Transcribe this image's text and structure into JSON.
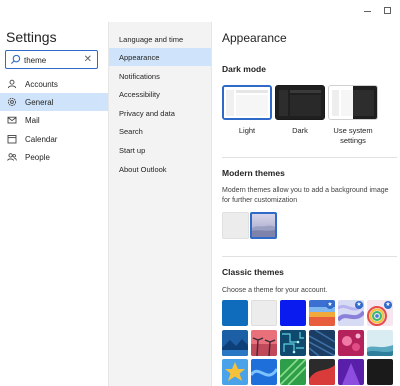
{
  "window": {
    "minimize_icon": "minimize-icon",
    "maximize_icon": "maximize-icon"
  },
  "sidebar": {
    "title": "Settings",
    "search": {
      "value": "theme",
      "clear_icon": "✕"
    },
    "items": [
      {
        "label": "Accounts",
        "icon": "person-icon",
        "active": false
      },
      {
        "label": "General",
        "icon": "gear-icon",
        "active": true
      },
      {
        "label": "Mail",
        "icon": "mail-icon",
        "active": false
      },
      {
        "label": "Calendar",
        "icon": "calendar-icon",
        "active": false
      },
      {
        "label": "People",
        "icon": "people-icon",
        "active": false
      }
    ]
  },
  "subnav": {
    "items": [
      {
        "label": "Language and time",
        "active": false
      },
      {
        "label": "Appearance",
        "active": true
      },
      {
        "label": "Notifications",
        "active": false
      },
      {
        "label": "Accessibility",
        "active": false
      },
      {
        "label": "Privacy and data",
        "active": false
      },
      {
        "label": "Search",
        "active": false
      },
      {
        "label": "Start up",
        "active": false
      },
      {
        "label": "About Outlook",
        "active": false
      }
    ]
  },
  "main": {
    "title": "Appearance",
    "dark_mode": {
      "heading": "Dark mode",
      "options": [
        {
          "label": "Light",
          "selected": true
        },
        {
          "label": "Dark",
          "selected": false
        },
        {
          "label_line1": "Use system",
          "label_line2": "settings",
          "selected": false
        }
      ]
    },
    "modern_themes": {
      "heading": "Modern themes",
      "description_line1": "Modern themes allow you to add a background image",
      "description_line2": "for further customization",
      "selected_index": 1
    },
    "classic_themes": {
      "heading": "Classic themes",
      "description": "Choose a theme for your account.",
      "star_symbol": "★"
    }
  },
  "colors": {
    "accent": "#2f6ac8",
    "selected_bg": "#cfe4fa",
    "middle_bg": "#f3f3f3"
  }
}
